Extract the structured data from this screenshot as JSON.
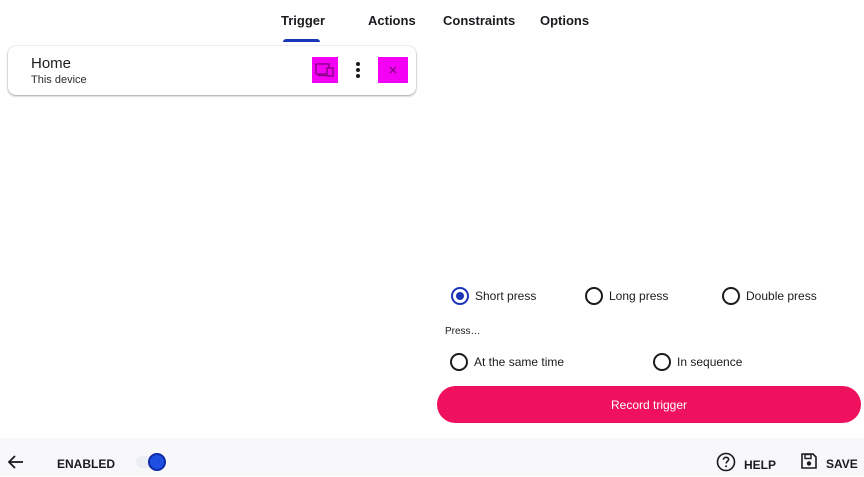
{
  "tabs": [
    {
      "label": "Trigger",
      "active": true
    },
    {
      "label": "Actions",
      "active": false
    },
    {
      "label": "Constraints",
      "active": false
    },
    {
      "label": "Options",
      "active": false
    }
  ],
  "trigger_card": {
    "title": "Home",
    "subtitle": "This device",
    "icons": [
      "device-settings-icon",
      "more-vertical-icon",
      "remove-icon"
    ]
  },
  "press_type": {
    "options": [
      {
        "label": "Short press",
        "checked": true
      },
      {
        "label": "Long press",
        "checked": false
      },
      {
        "label": "Double press",
        "checked": false
      }
    ]
  },
  "press_mode": {
    "label": "Press…",
    "options": [
      {
        "label": "At the same time",
        "checked": false
      },
      {
        "label": "In sequence",
        "checked": false
      }
    ]
  },
  "record_button": {
    "label": "Record trigger"
  },
  "bottom_bar": {
    "enabled_label": "ENABLED",
    "enabled": true,
    "help_label": "HELP",
    "save_label": "SAVE"
  },
  "colors": {
    "accent": "#1a35b8",
    "record_button": "#f0115e",
    "icon_highlight": "#f400f4",
    "toggle_thumb": "#1f4fe0"
  }
}
